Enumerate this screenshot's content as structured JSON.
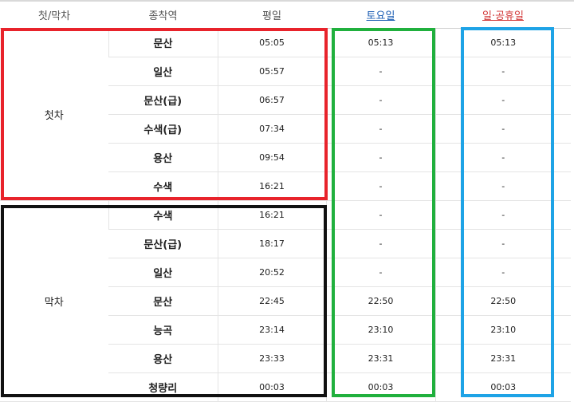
{
  "headers": [
    "첫/막차",
    "종착역",
    "평일",
    "토요일",
    "일·공휴일"
  ],
  "groups": {
    "first": "첫차",
    "last": "막차"
  },
  "first_rows": [
    {
      "station": "문산",
      "weekday": "05:05",
      "saturday": "05:13",
      "holiday": "05:13"
    },
    {
      "station": "일산",
      "weekday": "05:57",
      "saturday": "-",
      "holiday": "-"
    },
    {
      "station": "문산(급)",
      "weekday": "06:57",
      "saturday": "-",
      "holiday": "-"
    },
    {
      "station": "수색(급)",
      "weekday": "07:34",
      "saturday": "-",
      "holiday": "-"
    },
    {
      "station": "용산",
      "weekday": "09:54",
      "saturday": "-",
      "holiday": "-"
    },
    {
      "station": "수색",
      "weekday": "16:21",
      "saturday": "-",
      "holiday": "-"
    }
  ],
  "last_rows": [
    {
      "station": "수색",
      "weekday": "16:21",
      "saturday": "-",
      "holiday": "-"
    },
    {
      "station": "문산(급)",
      "weekday": "18:17",
      "saturday": "-",
      "holiday": "-"
    },
    {
      "station": "일산",
      "weekday": "20:52",
      "saturday": "-",
      "holiday": "-"
    },
    {
      "station": "문산",
      "weekday": "22:45",
      "saturday": "22:50",
      "holiday": "22:50"
    },
    {
      "station": "능곡",
      "weekday": "23:14",
      "saturday": "23:10",
      "holiday": "23:10"
    },
    {
      "station": "용산",
      "weekday": "23:33",
      "saturday": "23:31",
      "holiday": "23:31"
    },
    {
      "station": "청량리",
      "weekday": "00:03",
      "saturday": "00:03",
      "holiday": "00:03"
    }
  ],
  "annotation_colors": {
    "red": "#e8232b",
    "black": "#111111",
    "green": "#20b03d",
    "blue": "#1ea3e6"
  }
}
